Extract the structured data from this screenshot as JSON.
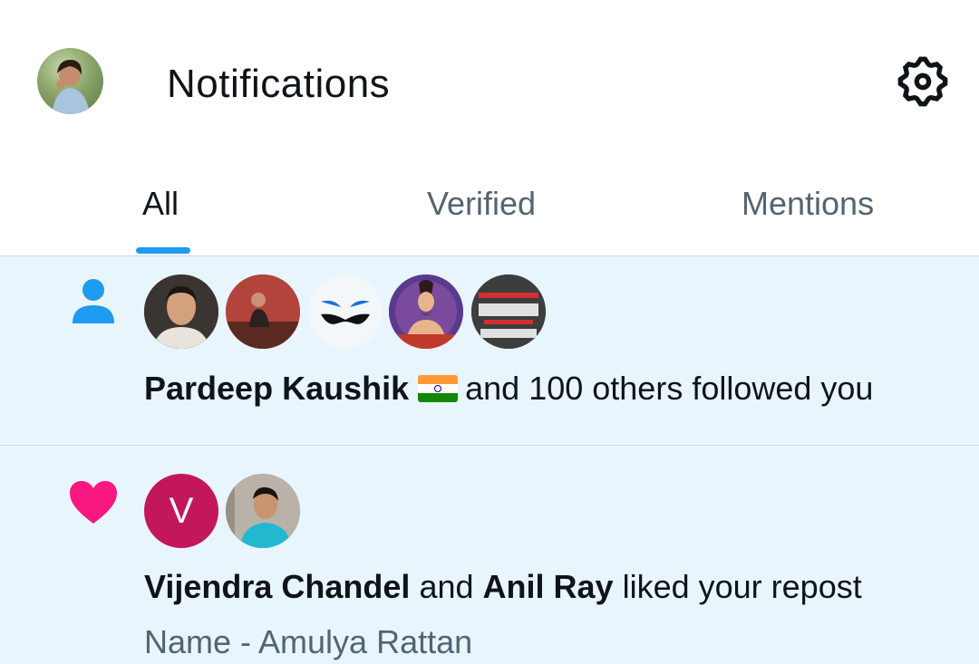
{
  "header": {
    "title": "Notifications",
    "avatar_icon": "profile-avatar",
    "settings_icon": "gear-icon"
  },
  "tabs": [
    {
      "label": "All",
      "active": true
    },
    {
      "label": "Verified",
      "active": false
    },
    {
      "label": "Mentions",
      "active": false
    }
  ],
  "notifications": [
    {
      "type": "follow",
      "icon": "person-icon",
      "icon_color": "#1d9bf0",
      "avatar_count": 5,
      "actor": "Pardeep Kaushik",
      "flag": "india-flag",
      "text": "and 100 others followed you"
    },
    {
      "type": "like",
      "icon": "heart-icon",
      "icon_color": "#f91880",
      "avatar_letter": "V",
      "avatar_letter_color": "#c2185b",
      "actor1": "Vijendra Chandel",
      "connector": "and",
      "actor2": "Anil Ray",
      "text": "liked your repost",
      "subtext": "Name - Amulya Rattan"
    }
  ],
  "colors": {
    "accent": "#1d9bf0",
    "unread_bg": "#e8f5fd",
    "secondary_text": "#536471",
    "primary_text": "#0f1419"
  }
}
